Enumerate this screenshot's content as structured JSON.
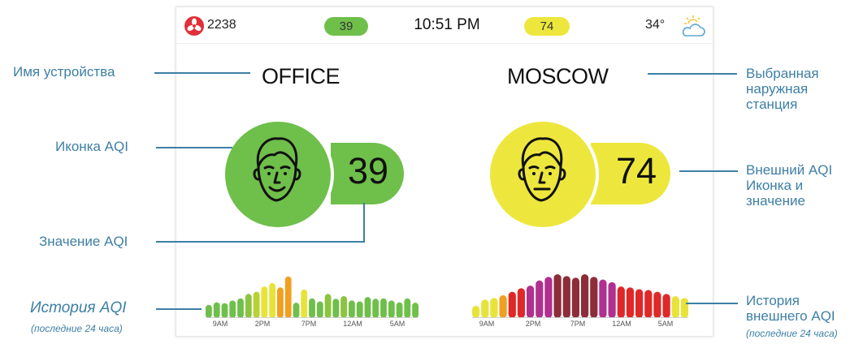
{
  "status_bar": {
    "fan_count": "2238",
    "indoor_aqi_badge": "39",
    "time": "10:51 PM",
    "outdoor_aqi_badge": "74",
    "temperature": "34°",
    "weather_icon": "partly-cloudy-icon"
  },
  "indoor": {
    "device_name": "OFFICE",
    "aqi_value": "39",
    "color": "#6fbf4b",
    "history": {
      "time_labels": [
        "9AM",
        "2PM",
        "7PM",
        "12AM",
        "5AM"
      ],
      "bars": [
        {
          "v": 0.3,
          "c": "#6fbf4b"
        },
        {
          "v": 0.36,
          "c": "#6fbf4b"
        },
        {
          "v": 0.34,
          "c": "#6fbf4b"
        },
        {
          "v": 0.4,
          "c": "#6fbf4b"
        },
        {
          "v": 0.45,
          "c": "#6fbf4b"
        },
        {
          "v": 0.55,
          "c": "#8cc43f"
        },
        {
          "v": 0.6,
          "c": "#b7d233"
        },
        {
          "v": 0.72,
          "c": "#e8e33a"
        },
        {
          "v": 0.8,
          "c": "#e8e33a"
        },
        {
          "v": 0.7,
          "c": "#f0a020"
        },
        {
          "v": 0.95,
          "c": "#f0a020"
        },
        {
          "v": 0.35,
          "c": "#6fbf4b"
        },
        {
          "v": 0.65,
          "c": "#e8e33a"
        },
        {
          "v": 0.45,
          "c": "#6fbf4b"
        },
        {
          "v": 0.38,
          "c": "#6fbf4b"
        },
        {
          "v": 0.55,
          "c": "#8cc43f"
        },
        {
          "v": 0.44,
          "c": "#6fbf4b"
        },
        {
          "v": 0.5,
          "c": "#8cc43f"
        },
        {
          "v": 0.4,
          "c": "#6fbf4b"
        },
        {
          "v": 0.38,
          "c": "#6fbf4b"
        },
        {
          "v": 0.48,
          "c": "#6fbf4b"
        },
        {
          "v": 0.44,
          "c": "#6fbf4b"
        },
        {
          "v": 0.45,
          "c": "#6fbf4b"
        },
        {
          "v": 0.4,
          "c": "#6fbf4b"
        },
        {
          "v": 0.36,
          "c": "#6fbf4b"
        },
        {
          "v": 0.45,
          "c": "#6fbf4b"
        },
        {
          "v": 0.35,
          "c": "#6fbf4b"
        }
      ]
    }
  },
  "outdoor": {
    "station_name": "MOSCOW",
    "aqi_value": "74",
    "color": "#ede73d",
    "history": {
      "time_labels": [
        "9AM",
        "2PM",
        "7PM",
        "12AM",
        "5AM"
      ],
      "bars": [
        {
          "v": 0.28,
          "c": "#e8e33a"
        },
        {
          "v": 0.42,
          "c": "#e8e33a"
        },
        {
          "v": 0.46,
          "c": "#e8e33a"
        },
        {
          "v": 0.52,
          "c": "#f0a020"
        },
        {
          "v": 0.6,
          "c": "#e02828"
        },
        {
          "v": 0.68,
          "c": "#e02828"
        },
        {
          "v": 0.74,
          "c": "#b03090"
        },
        {
          "v": 0.86,
          "c": "#b03090"
        },
        {
          "v": 0.94,
          "c": "#b03090"
        },
        {
          "v": 1.0,
          "c": "#8e2d3a"
        },
        {
          "v": 0.96,
          "c": "#8e2d3a"
        },
        {
          "v": 0.92,
          "c": "#8e2d3a"
        },
        {
          "v": 1.0,
          "c": "#8e2d3a"
        },
        {
          "v": 0.94,
          "c": "#8e2d3a"
        },
        {
          "v": 0.88,
          "c": "#b03090"
        },
        {
          "v": 0.82,
          "c": "#b03090"
        },
        {
          "v": 0.72,
          "c": "#e02828"
        },
        {
          "v": 0.7,
          "c": "#e02828"
        },
        {
          "v": 0.66,
          "c": "#e02828"
        },
        {
          "v": 0.64,
          "c": "#e02828"
        },
        {
          "v": 0.6,
          "c": "#e02828"
        },
        {
          "v": 0.55,
          "c": "#e02828"
        },
        {
          "v": 0.5,
          "c": "#e8e33a"
        },
        {
          "v": 0.46,
          "c": "#e8e33a"
        }
      ]
    }
  },
  "callouts": {
    "device_name": "Имя устройства",
    "aqi_icon": "Иконка AQI",
    "aqi_value": "Значение AQI",
    "aqi_history": "История AQI",
    "aqi_history_sub": "(последние 24 часа)",
    "outdoor_station": [
      "Выбранная",
      "наружная",
      "станция"
    ],
    "outdoor_aqi": [
      "Внешний AQI",
      "Иконка и",
      "значение"
    ],
    "outdoor_history": [
      "История",
      "внешнего AQI"
    ],
    "outdoor_history_sub": "(последние 24 часа)"
  },
  "colors": {
    "accent_line": "#3d7fa5",
    "green": "#6fbf4b",
    "yellow": "#ede73d",
    "fan_red": "#e0303a"
  }
}
